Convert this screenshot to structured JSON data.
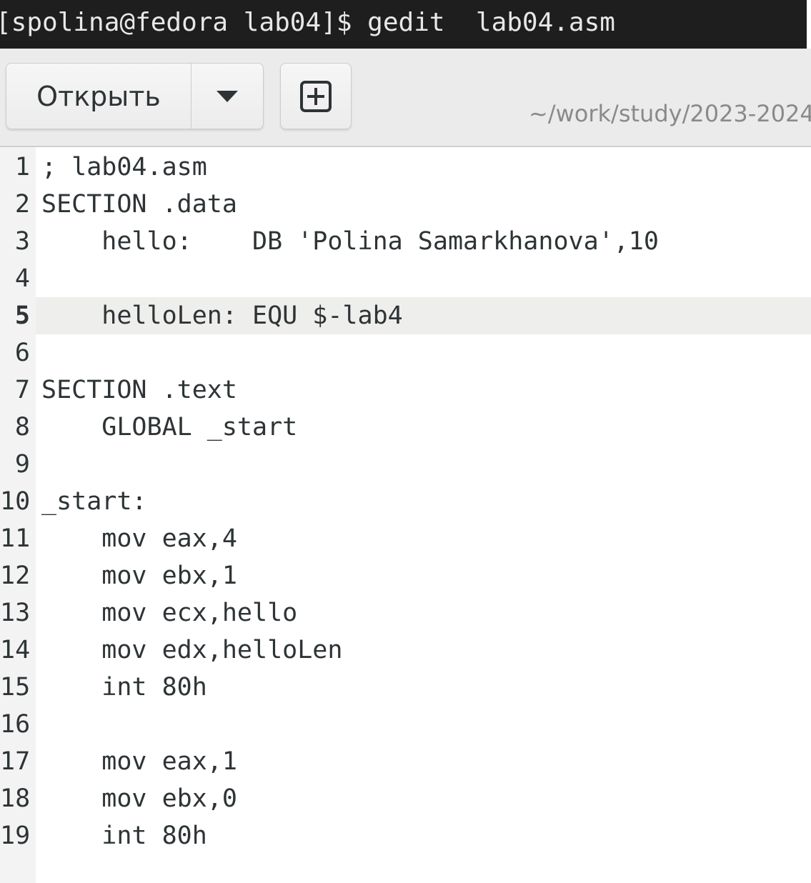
{
  "terminal": {
    "prompt_text": "[spolina@fedora lab04]$ gedit  lab04.asm"
  },
  "toolbar": {
    "open_label": "Открыть",
    "open_menu_icon": "chevron-down-icon",
    "new_tab_icon": "new-document-icon",
    "subtitle_path": "~/work/study/2023-2024"
  },
  "editor": {
    "current_line": 5,
    "lines": [
      {
        "n": "1",
        "text": "; lab04.asm"
      },
      {
        "n": "2",
        "text": "SECTION .data"
      },
      {
        "n": "3",
        "text": "    hello:    DB 'Polina Samarkhanova',10"
      },
      {
        "n": "4",
        "text": ""
      },
      {
        "n": "5",
        "text": "    helloLen: EQU $-lab4"
      },
      {
        "n": "6",
        "text": ""
      },
      {
        "n": "7",
        "text": "SECTION .text"
      },
      {
        "n": "8",
        "text": "    GLOBAL _start"
      },
      {
        "n": "9",
        "text": ""
      },
      {
        "n": "10",
        "text": "_start:"
      },
      {
        "n": "11",
        "text": "    mov eax,4"
      },
      {
        "n": "12",
        "text": "    mov ebx,1"
      },
      {
        "n": "13",
        "text": "    mov ecx,hello"
      },
      {
        "n": "14",
        "text": "    mov edx,helloLen"
      },
      {
        "n": "15",
        "text": "    int 80h"
      },
      {
        "n": "16",
        "text": ""
      },
      {
        "n": "17",
        "text": "    mov eax,1"
      },
      {
        "n": "18",
        "text": "    mov ebx,0"
      },
      {
        "n": "19",
        "text": "    int 80h"
      }
    ]
  }
}
